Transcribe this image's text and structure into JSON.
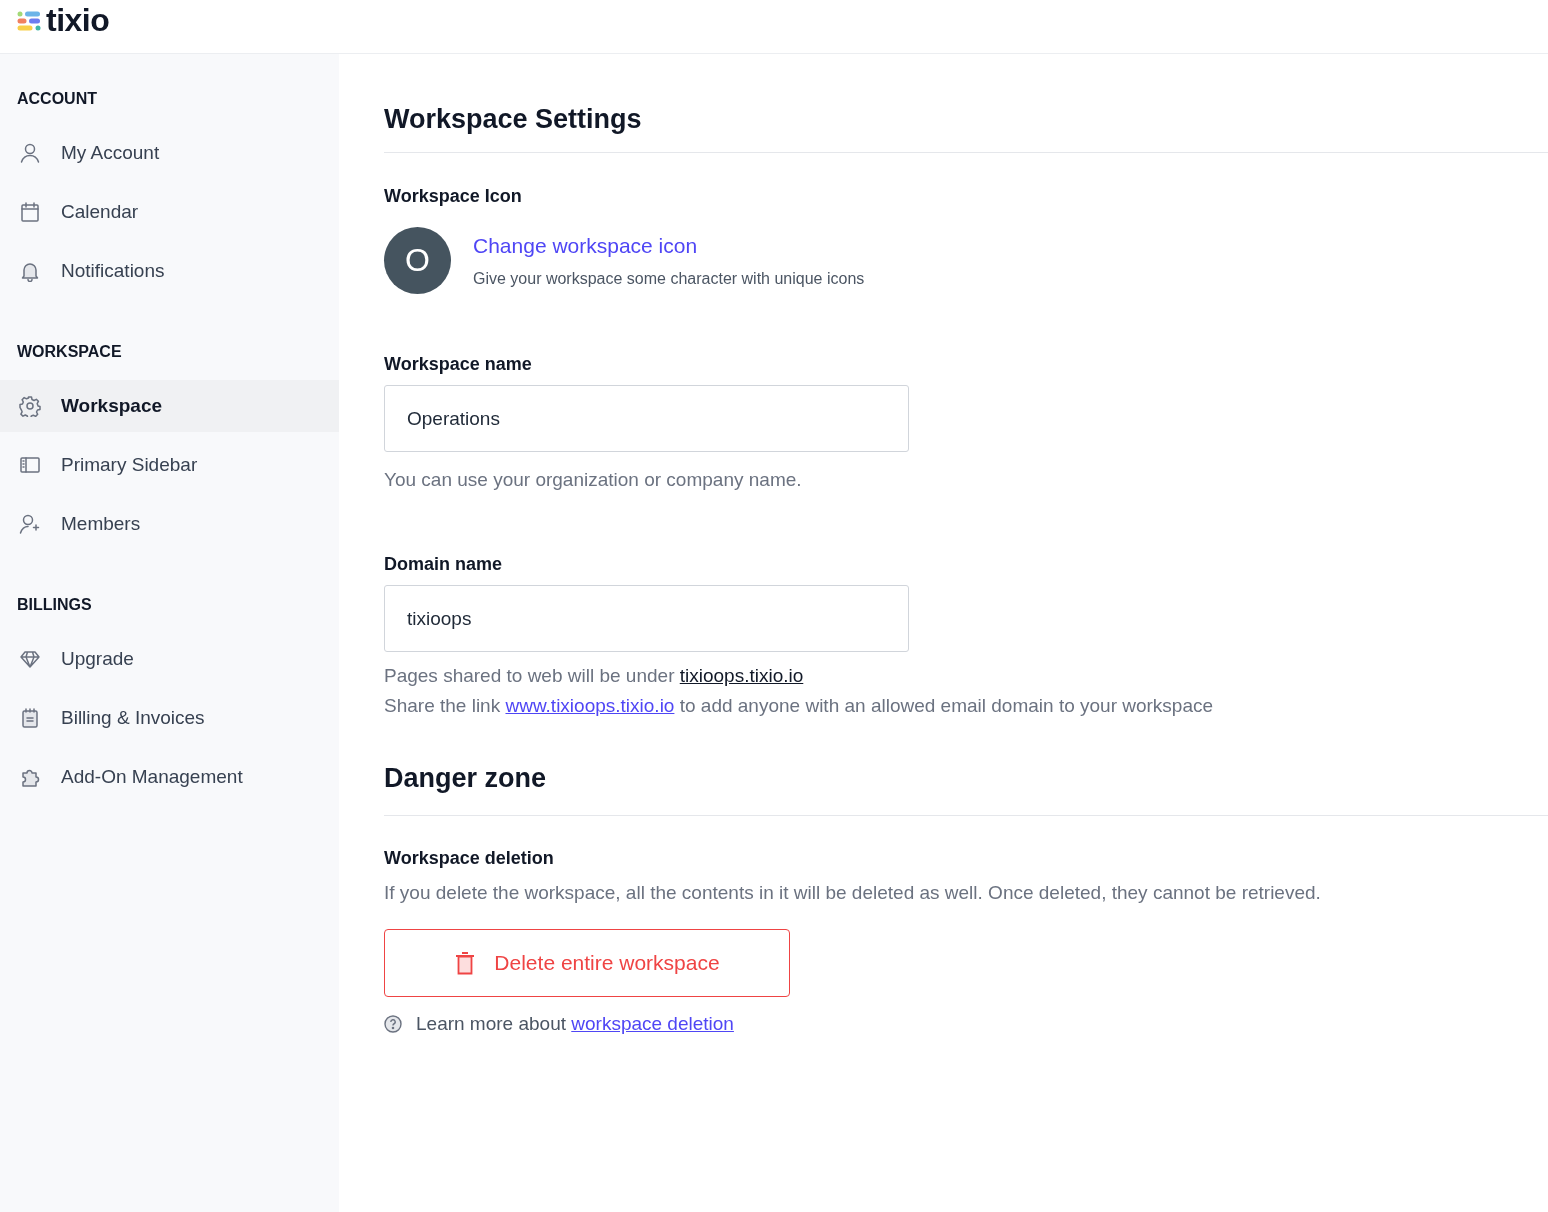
{
  "logo": {
    "text": "tixio"
  },
  "sidebar": {
    "sections": [
      {
        "title": "ACCOUNT",
        "items": [
          {
            "label": "My Account",
            "selected": false
          },
          {
            "label": "Calendar",
            "selected": false
          },
          {
            "label": "Notifications",
            "selected": false
          }
        ]
      },
      {
        "title": "WORKSPACE",
        "items": [
          {
            "label": "Workspace",
            "selected": true
          },
          {
            "label": "Primary Sidebar",
            "selected": false
          },
          {
            "label": "Members",
            "selected": false
          }
        ]
      },
      {
        "title": "BILLINGS",
        "items": [
          {
            "label": "Upgrade",
            "selected": false
          },
          {
            "label": "Billing & Invoices",
            "selected": false
          },
          {
            "label": "Add-On Management",
            "selected": false
          }
        ]
      }
    ]
  },
  "page_title": "Workspace Settings",
  "workspace_icon": {
    "heading": "Workspace Icon",
    "avatar_letter": "O",
    "link": "Change workspace icon",
    "hint": "Give your workspace some character with unique icons"
  },
  "workspace_name": {
    "label": "Workspace name",
    "value": "Operations",
    "help": "You can use your organization or company name."
  },
  "domain_name": {
    "label": "Domain name",
    "value": "tixioops",
    "notes": [
      {
        "before": "Pages shared to web will be under",
        "link": "tixioops.tixio.io"
      },
      {
        "before": "Share the link",
        "link": "www.tixioops.tixio.io",
        "after": "to add anyone with an allowed email domain to your workspace"
      }
    ]
  },
  "danger_zone": {
    "title": "Danger zone",
    "heading": "Workspace deletion",
    "description": "If you delete the workspace, all the contents in it will be deleted as well. Once deleted, they cannot be retrieved.",
    "button": "Delete entire workspace",
    "learn_more": {
      "before": "Learn more about",
      "link": "workspace deletion"
    }
  }
}
